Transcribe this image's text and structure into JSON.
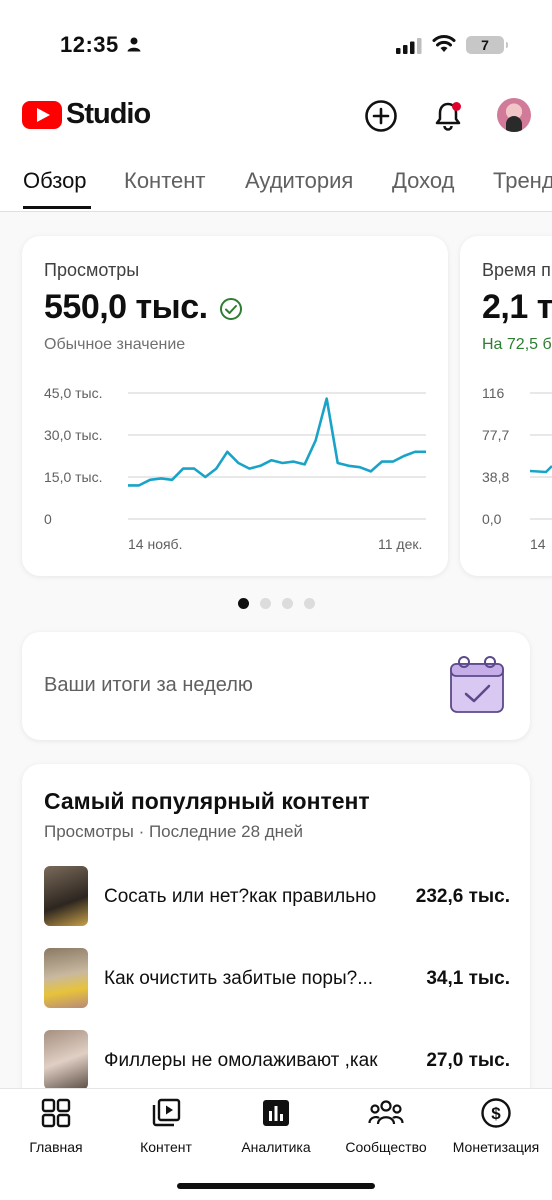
{
  "status_bar": {
    "time": "12:35",
    "battery": "7"
  },
  "header": {
    "logo_text": "Studio",
    "icons": [
      "create-icon",
      "notifications-icon",
      "avatar"
    ]
  },
  "tabs": [
    {
      "label": "Обзор",
      "active": true
    },
    {
      "label": "Контент"
    },
    {
      "label": "Аудитория"
    },
    {
      "label": "Доход"
    },
    {
      "label": "Тренд"
    }
  ],
  "metrics": [
    {
      "label": "Просмотры",
      "value": "550,0 тыс.",
      "sub": "Обычное значение",
      "y_ticks": [
        "45,0 тыс.",
        "30,0 тыс.",
        "15,0 тыс.",
        "0"
      ],
      "x_ticks": [
        "14 нояб.",
        "11 дек."
      ]
    },
    {
      "label": "Время п",
      "value": "2,1 т",
      "sub": "На 72,5 б",
      "y_ticks": [
        "116",
        "77,7",
        "38,8",
        "0,0"
      ],
      "x_ticks": [
        "14"
      ]
    }
  ],
  "chart_data": {
    "type": "line",
    "title": "Просмотры",
    "ylim": [
      0,
      45000
    ],
    "y_ticks": [
      "45,0 тыс.",
      "30,0 тыс.",
      "15,0 тыс.",
      "0"
    ],
    "x_ticks": [
      "14 нояб.",
      "11 дек."
    ],
    "color": "#1aa3c8",
    "series": [
      {
        "values": [
          12000,
          12000,
          14000,
          14500,
          14000,
          18000,
          18000,
          15000,
          18000,
          24000,
          20000,
          18000,
          19000,
          21000,
          20000,
          20500,
          19500,
          28000,
          43000,
          20000,
          19000,
          18500,
          17000,
          20500,
          20500,
          22500,
          24000,
          24000
        ]
      }
    ]
  },
  "pager": {
    "count": 4,
    "active": 0
  },
  "weekly": {
    "label": "Ваши итоги за неделю"
  },
  "popular": {
    "title": "Самый популярный контент",
    "subtitle": "Просмотры · Последние 28 дней",
    "items": [
      {
        "title": "Сосать или нет?как правильно",
        "views": "232,6 тыс."
      },
      {
        "title": "Как очистить забитые поры?...",
        "views": "34,1 тыс."
      },
      {
        "title": "Филлеры не омолаживают ,как",
        "views": "27,0 тыс."
      }
    ]
  },
  "bottom_nav": [
    {
      "label": "Главная",
      "icon": "dashboard-icon"
    },
    {
      "label": "Контент",
      "icon": "content-icon"
    },
    {
      "label": "Аналитика",
      "icon": "analytics-icon",
      "active": true
    },
    {
      "label": "Сообщество",
      "icon": "community-icon"
    },
    {
      "label": "Монетизация",
      "icon": "monetization-icon"
    }
  ]
}
